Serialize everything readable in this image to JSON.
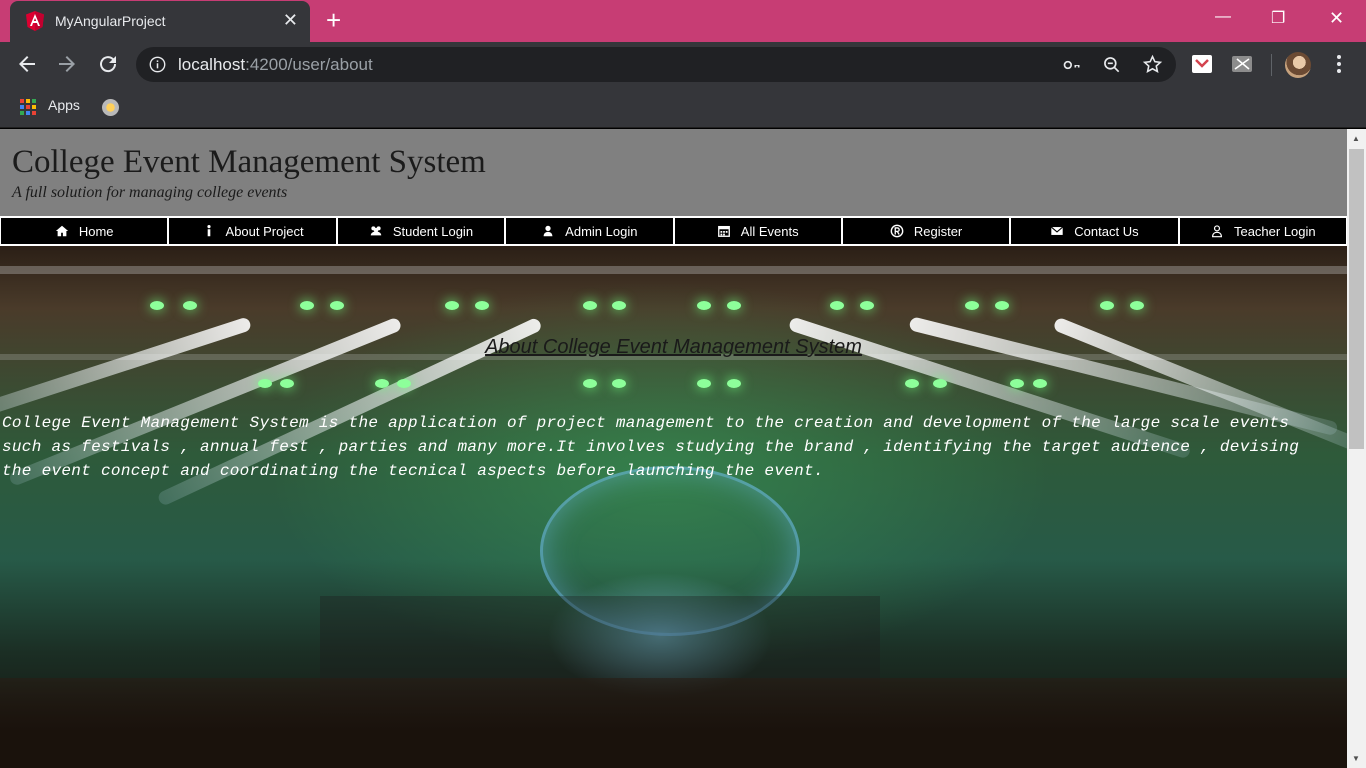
{
  "browser": {
    "tab_title": "MyAngularProject",
    "tab_close": "✕",
    "new_tab": "+",
    "url_host": "localhost",
    "url_rest": ":4200/user/about",
    "bookmarks": {
      "apps_label": "Apps"
    },
    "window": {
      "minimize": "—",
      "restore": "❐",
      "close": "✕"
    },
    "colors": {
      "frame": "#c73d74",
      "toolbar": "#35363a",
      "omnibox": "#202124"
    }
  },
  "page": {
    "site_title": "College Event Management System",
    "site_subtitle": "A full solution for managing college events",
    "nav": [
      {
        "label": "Home",
        "icon": "home-icon"
      },
      {
        "label": "About Project",
        "icon": "info-icon"
      },
      {
        "label": "Student Login",
        "icon": "users-icon"
      },
      {
        "label": "Admin Login",
        "icon": "user-icon"
      },
      {
        "label": "All Events",
        "icon": "calendar-icon"
      },
      {
        "label": "Register",
        "icon": "registered-icon"
      },
      {
        "label": "Contact Us",
        "icon": "envelope-icon"
      },
      {
        "label": "Teacher Login",
        "icon": "user-outline-icon"
      }
    ],
    "about_heading": "About College Event Management System",
    "about_text": "College Event Management System is the application of project management to the creation and development of the large scale events such as festivals , annual fest , parties and many more.It involves studying the brand , identifying the target audience , devising the event concept and coordinating the tecnical aspects before launching the event.",
    "colors": {
      "header_bg": "#808080",
      "nav_bg": "#000000"
    }
  }
}
